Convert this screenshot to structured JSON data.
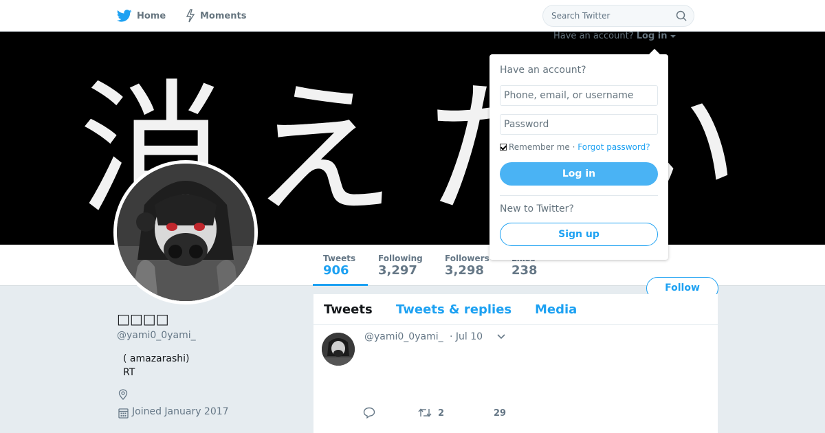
{
  "nav": {
    "home_label": "Home",
    "moments_label": "Moments",
    "search_placeholder": "Search Twitter"
  },
  "login": {
    "trigger_text": "Have an account?",
    "trigger_link": "Log in",
    "title": "Have an account?",
    "username_placeholder": "Phone, email, or username",
    "password_placeholder": "Password",
    "remember_label": "Remember me",
    "separator": " · ",
    "forgot_label": "Forgot password?",
    "login_button": "Log in",
    "new_to": "New to Twitter?",
    "signup_button": "Sign up"
  },
  "banner": {
    "text": "消えたい"
  },
  "stats": [
    {
      "label": "Tweets",
      "value": "906"
    },
    {
      "label": "Following",
      "value": "3,297"
    },
    {
      "label": "Followers",
      "value": "3,298"
    },
    {
      "label": "Likes",
      "value": "238"
    }
  ],
  "follow_button": "Follow",
  "profile": {
    "name": "□□□□",
    "handle": "@yami0_0yami_",
    "bio_line1": "(   amazarashi)",
    "bio_line2": "RT",
    "joined": "Joined January 2017"
  },
  "tabs": [
    "Tweets",
    "Tweets & replies",
    "Media"
  ],
  "tweet": {
    "handle": "@yami0_0yami_",
    "time": "· Jul 10",
    "retweets": "2",
    "likes": "29"
  },
  "colors": {
    "accent": "#1da1f2",
    "background": "#e6ecf0"
  }
}
